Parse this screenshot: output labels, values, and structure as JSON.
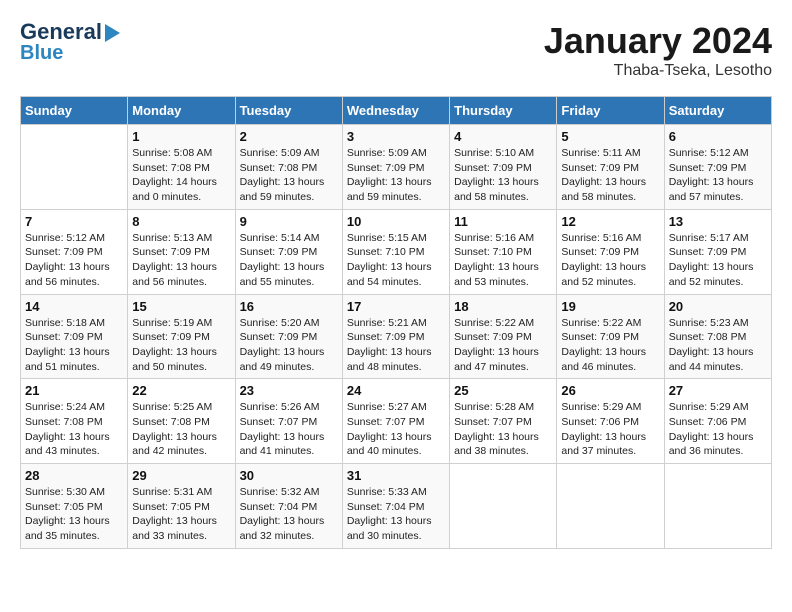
{
  "header": {
    "logo_line1": "General",
    "logo_line2": "Blue",
    "title": "January 2024",
    "subtitle": "Thaba-Tseka, Lesotho"
  },
  "days_of_week": [
    "Sunday",
    "Monday",
    "Tuesday",
    "Wednesday",
    "Thursday",
    "Friday",
    "Saturday"
  ],
  "weeks": [
    [
      {
        "day": "",
        "sunrise": "",
        "sunset": "",
        "daylight": ""
      },
      {
        "day": "1",
        "sunrise": "Sunrise: 5:08 AM",
        "sunset": "Sunset: 7:08 PM",
        "daylight": "Daylight: 14 hours and 0 minutes."
      },
      {
        "day": "2",
        "sunrise": "Sunrise: 5:09 AM",
        "sunset": "Sunset: 7:08 PM",
        "daylight": "Daylight: 13 hours and 59 minutes."
      },
      {
        "day": "3",
        "sunrise": "Sunrise: 5:09 AM",
        "sunset": "Sunset: 7:09 PM",
        "daylight": "Daylight: 13 hours and 59 minutes."
      },
      {
        "day": "4",
        "sunrise": "Sunrise: 5:10 AM",
        "sunset": "Sunset: 7:09 PM",
        "daylight": "Daylight: 13 hours and 58 minutes."
      },
      {
        "day": "5",
        "sunrise": "Sunrise: 5:11 AM",
        "sunset": "Sunset: 7:09 PM",
        "daylight": "Daylight: 13 hours and 58 minutes."
      },
      {
        "day": "6",
        "sunrise": "Sunrise: 5:12 AM",
        "sunset": "Sunset: 7:09 PM",
        "daylight": "Daylight: 13 hours and 57 minutes."
      }
    ],
    [
      {
        "day": "7",
        "sunrise": "Sunrise: 5:12 AM",
        "sunset": "Sunset: 7:09 PM",
        "daylight": "Daylight: 13 hours and 56 minutes."
      },
      {
        "day": "8",
        "sunrise": "Sunrise: 5:13 AM",
        "sunset": "Sunset: 7:09 PM",
        "daylight": "Daylight: 13 hours and 56 minutes."
      },
      {
        "day": "9",
        "sunrise": "Sunrise: 5:14 AM",
        "sunset": "Sunset: 7:09 PM",
        "daylight": "Daylight: 13 hours and 55 minutes."
      },
      {
        "day": "10",
        "sunrise": "Sunrise: 5:15 AM",
        "sunset": "Sunset: 7:10 PM",
        "daylight": "Daylight: 13 hours and 54 minutes."
      },
      {
        "day": "11",
        "sunrise": "Sunrise: 5:16 AM",
        "sunset": "Sunset: 7:10 PM",
        "daylight": "Daylight: 13 hours and 53 minutes."
      },
      {
        "day": "12",
        "sunrise": "Sunrise: 5:16 AM",
        "sunset": "Sunset: 7:09 PM",
        "daylight": "Daylight: 13 hours and 52 minutes."
      },
      {
        "day": "13",
        "sunrise": "Sunrise: 5:17 AM",
        "sunset": "Sunset: 7:09 PM",
        "daylight": "Daylight: 13 hours and 52 minutes."
      }
    ],
    [
      {
        "day": "14",
        "sunrise": "Sunrise: 5:18 AM",
        "sunset": "Sunset: 7:09 PM",
        "daylight": "Daylight: 13 hours and 51 minutes."
      },
      {
        "day": "15",
        "sunrise": "Sunrise: 5:19 AM",
        "sunset": "Sunset: 7:09 PM",
        "daylight": "Daylight: 13 hours and 50 minutes."
      },
      {
        "day": "16",
        "sunrise": "Sunrise: 5:20 AM",
        "sunset": "Sunset: 7:09 PM",
        "daylight": "Daylight: 13 hours and 49 minutes."
      },
      {
        "day": "17",
        "sunrise": "Sunrise: 5:21 AM",
        "sunset": "Sunset: 7:09 PM",
        "daylight": "Daylight: 13 hours and 48 minutes."
      },
      {
        "day": "18",
        "sunrise": "Sunrise: 5:22 AM",
        "sunset": "Sunset: 7:09 PM",
        "daylight": "Daylight: 13 hours and 47 minutes."
      },
      {
        "day": "19",
        "sunrise": "Sunrise: 5:22 AM",
        "sunset": "Sunset: 7:09 PM",
        "daylight": "Daylight: 13 hours and 46 minutes."
      },
      {
        "day": "20",
        "sunrise": "Sunrise: 5:23 AM",
        "sunset": "Sunset: 7:08 PM",
        "daylight": "Daylight: 13 hours and 44 minutes."
      }
    ],
    [
      {
        "day": "21",
        "sunrise": "Sunrise: 5:24 AM",
        "sunset": "Sunset: 7:08 PM",
        "daylight": "Daylight: 13 hours and 43 minutes."
      },
      {
        "day": "22",
        "sunrise": "Sunrise: 5:25 AM",
        "sunset": "Sunset: 7:08 PM",
        "daylight": "Daylight: 13 hours and 42 minutes."
      },
      {
        "day": "23",
        "sunrise": "Sunrise: 5:26 AM",
        "sunset": "Sunset: 7:07 PM",
        "daylight": "Daylight: 13 hours and 41 minutes."
      },
      {
        "day": "24",
        "sunrise": "Sunrise: 5:27 AM",
        "sunset": "Sunset: 7:07 PM",
        "daylight": "Daylight: 13 hours and 40 minutes."
      },
      {
        "day": "25",
        "sunrise": "Sunrise: 5:28 AM",
        "sunset": "Sunset: 7:07 PM",
        "daylight": "Daylight: 13 hours and 38 minutes."
      },
      {
        "day": "26",
        "sunrise": "Sunrise: 5:29 AM",
        "sunset": "Sunset: 7:06 PM",
        "daylight": "Daylight: 13 hours and 37 minutes."
      },
      {
        "day": "27",
        "sunrise": "Sunrise: 5:29 AM",
        "sunset": "Sunset: 7:06 PM",
        "daylight": "Daylight: 13 hours and 36 minutes."
      }
    ],
    [
      {
        "day": "28",
        "sunrise": "Sunrise: 5:30 AM",
        "sunset": "Sunset: 7:05 PM",
        "daylight": "Daylight: 13 hours and 35 minutes."
      },
      {
        "day": "29",
        "sunrise": "Sunrise: 5:31 AM",
        "sunset": "Sunset: 7:05 PM",
        "daylight": "Daylight: 13 hours and 33 minutes."
      },
      {
        "day": "30",
        "sunrise": "Sunrise: 5:32 AM",
        "sunset": "Sunset: 7:04 PM",
        "daylight": "Daylight: 13 hours and 32 minutes."
      },
      {
        "day": "31",
        "sunrise": "Sunrise: 5:33 AM",
        "sunset": "Sunset: 7:04 PM",
        "daylight": "Daylight: 13 hours and 30 minutes."
      },
      {
        "day": "",
        "sunrise": "",
        "sunset": "",
        "daylight": ""
      },
      {
        "day": "",
        "sunrise": "",
        "sunset": "",
        "daylight": ""
      },
      {
        "day": "",
        "sunrise": "",
        "sunset": "",
        "daylight": ""
      }
    ]
  ]
}
